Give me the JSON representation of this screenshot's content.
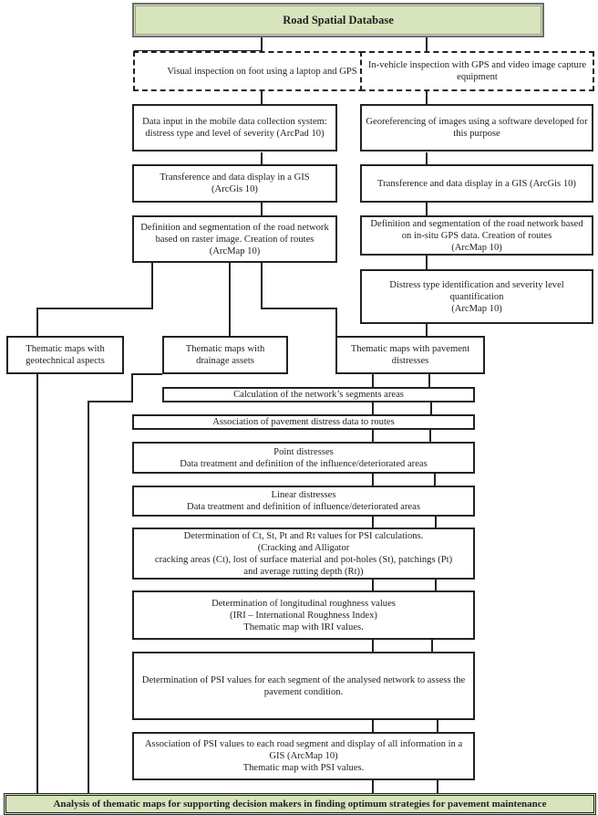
{
  "diagram": {
    "title": "Road Spatial Database",
    "left_branch": {
      "source": "Visual inspection on foot using a laptop and GPS",
      "steps": [
        "Data input in the mobile data collection system: distress type and level of severity (ArcPad 10)",
        "Transference and data display in a GIS\n(ArcGis 10)",
        "Definition and segmentation of the road network based on raster image. Creation of routes (ArcMap 10)"
      ]
    },
    "right_branch": {
      "source": "In-vehicle inspection with GPS and video image capture equipment",
      "steps": [
        "Georeferencing of images using a software developed for this purpose",
        "Transference and data display in a GIS (ArcGis 10)",
        "Definition and segmentation of the road network based on in-situ GPS data. Creation of routes\n(ArcMap 10)",
        "Distress type identification and severity level quantification\n(ArcMap 10)"
      ]
    },
    "thematic_maps": [
      "Thematic maps with\ngeotechnical aspects",
      "Thematic maps with\ndrainage assets",
      "Thematic maps with pavement\ndistresses"
    ],
    "processing_steps": [
      "Calculation of the network’s segments areas",
      "Association of pavement distress data to routes",
      "Point distresses\nData treatment and definition of the influence/deteriorated areas",
      "Linear distresses\nData treatment and definition of influence/deteriorated areas",
      "Determination of Ct, St, Pt and Rt values for PSI calculations.\n(Cracking and Alligator\ncracking areas (Ct), lost of surface material and pot-holes (St), patchings (Pt)\nand average rutting depth (Rt))",
      "Determination of longitudinal roughness values\n(IRI – International Roughness Index)\nThematic map with IRI values.",
      "Determination of PSI values for each segment of the analysed network to assess the pavement condition.",
      "Association of PSI values to each road segment and display of all information in a GIS (ArcMap 10)\nThematic map with PSI values."
    ],
    "conclusion": "Analysis of thematic maps for supporting decision makers in finding optimum strategies for pavement maintenance"
  },
  "colors": {
    "header_fill": "#d8e4bc",
    "line": "#222222"
  }
}
